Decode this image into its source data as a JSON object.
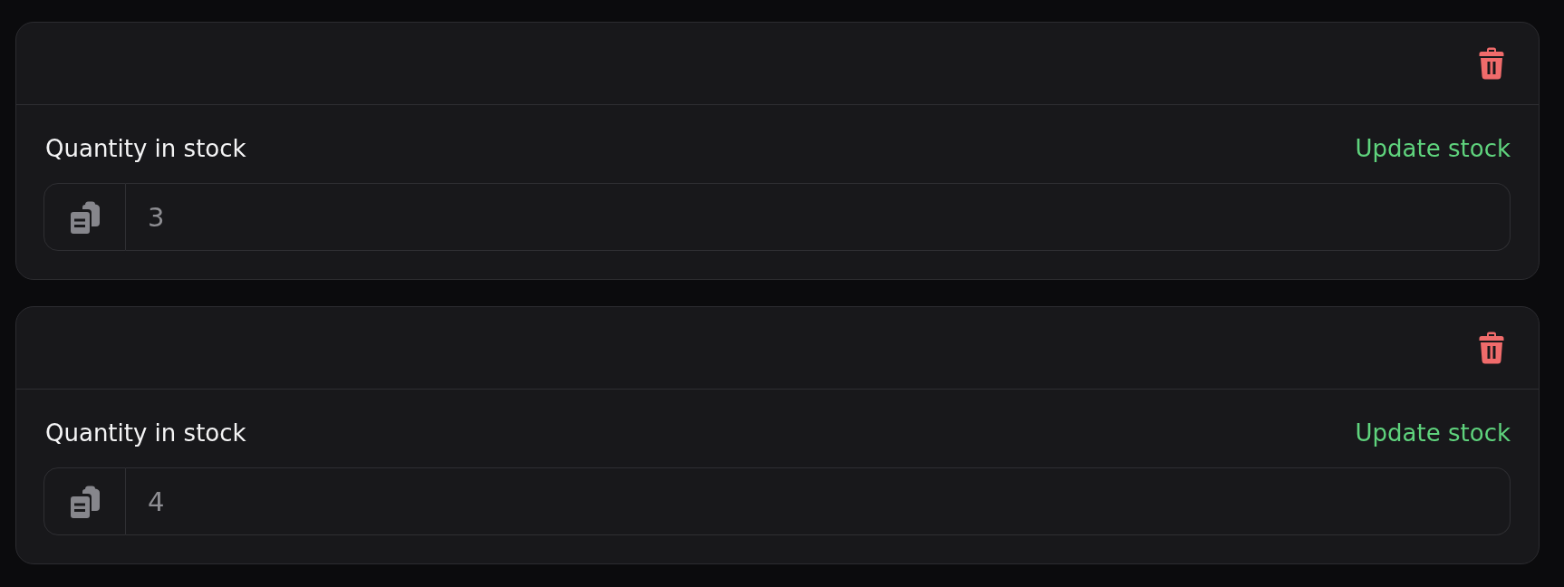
{
  "stock_cards": [
    {
      "label": "Quantity in stock",
      "action": "Update stock",
      "quantity": "3"
    },
    {
      "label": "Quantity in stock",
      "action": "Update stock",
      "quantity": "4"
    }
  ]
}
